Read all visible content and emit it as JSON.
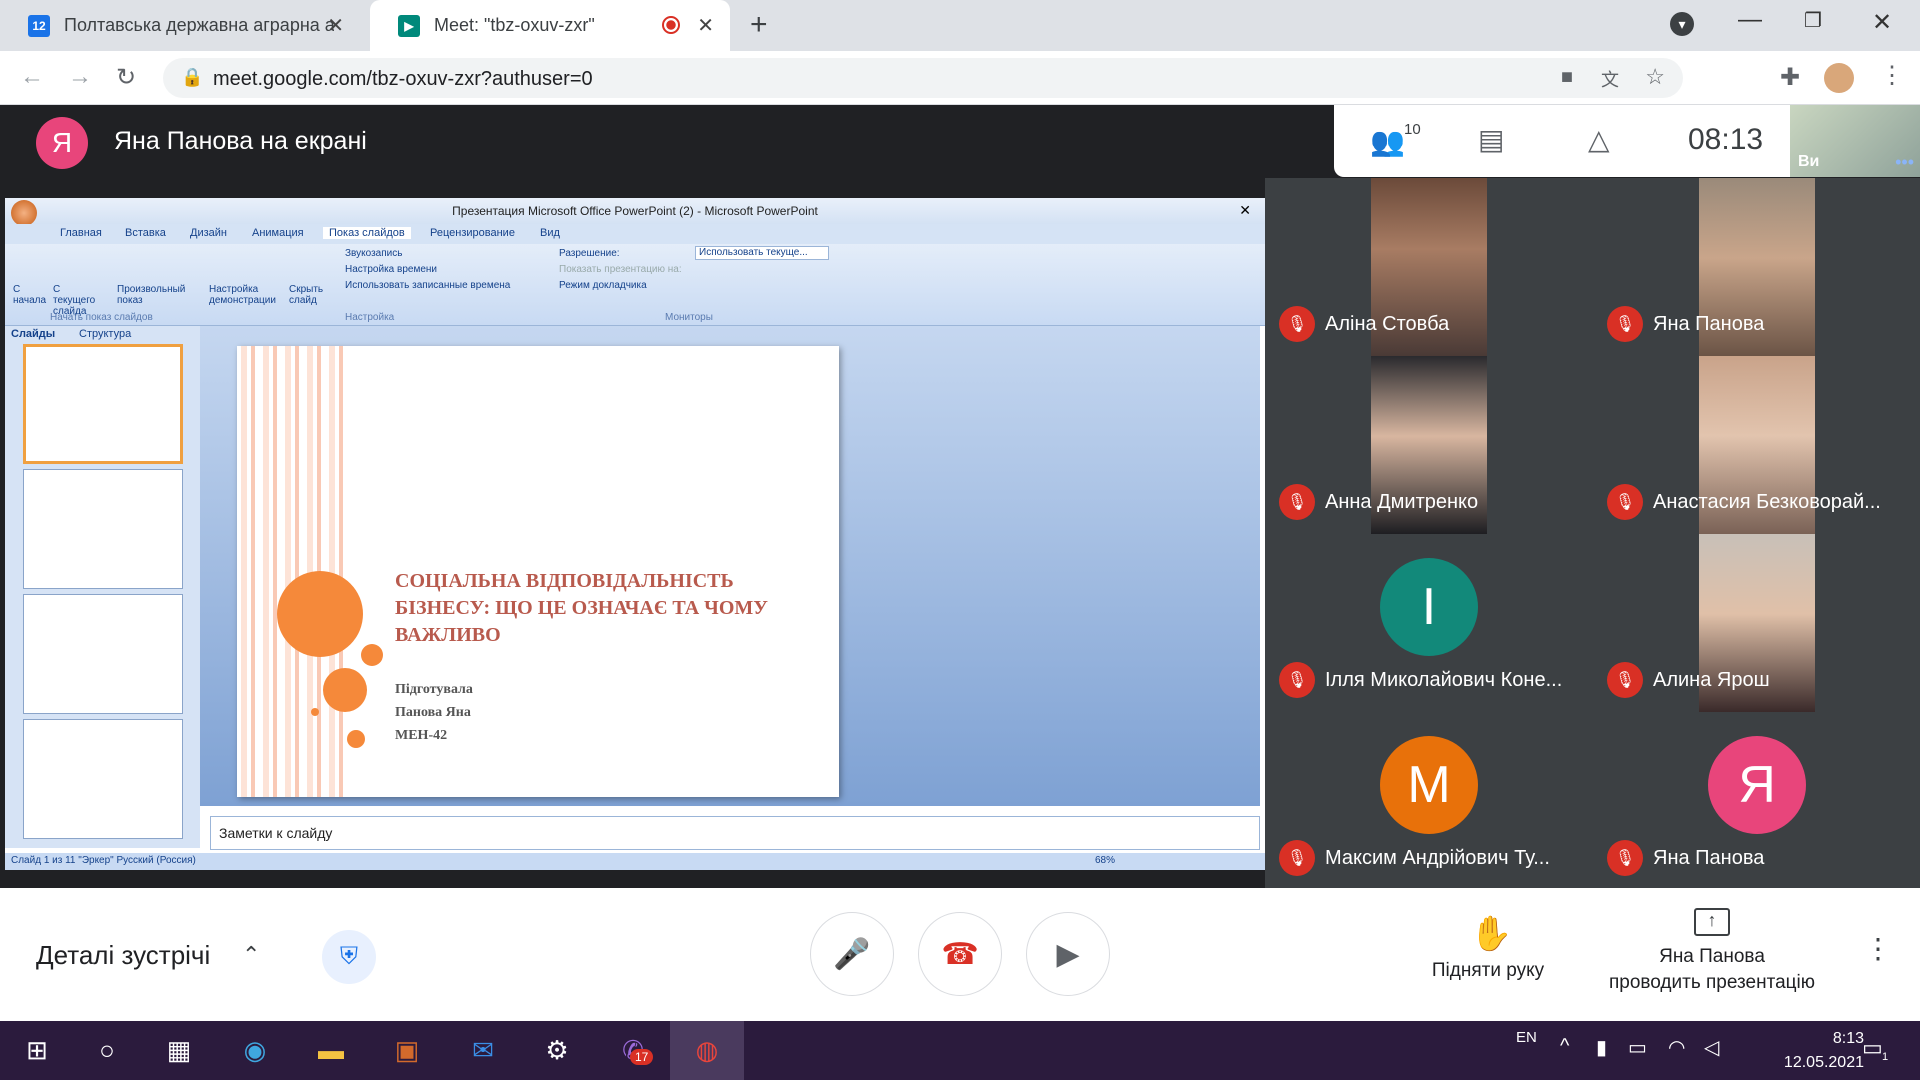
{
  "browser": {
    "tabs": [
      {
        "title": "Полтавська державна аграрна ак",
        "favicon": "12",
        "active": false
      },
      {
        "title": "Meet: \"tbz-oxuv-zxr\"",
        "active": true
      }
    ],
    "url": "meet.google.com/tbz-oxuv-zxr?authuser=0"
  },
  "meet": {
    "presenter_initial": "Я",
    "presenter_title": "Яна Панова на екрані",
    "participants_count": "10",
    "clock": "08:13",
    "self_label": "Ви",
    "participants": [
      {
        "name": "Аліна Стовба"
      },
      {
        "name": "Яна Панова"
      },
      {
        "name": "Анна Дмитренко"
      },
      {
        "name": "Анастасия Безковорай..."
      },
      {
        "name": "Ілля Миколайович Коне...",
        "initial": "I",
        "color": "#12897a"
      },
      {
        "name": "Алина Ярош"
      },
      {
        "name": "Максим Андрійович Ту...",
        "initial": "M",
        "color": "#e8710a"
      },
      {
        "name": "Яна Панова",
        "initial": "Я",
        "color": "#e8457b"
      }
    ],
    "details_label": "Деталі зустрічі",
    "raise_hand": "Підняти руку",
    "presenting_line1": "Яна Панова",
    "presenting_line2": "проводить презентацію"
  },
  "powerpoint": {
    "window_title": "Презентация Microsoft Office PowerPoint (2) - Microsoft PowerPoint",
    "tabs": [
      "Главная",
      "Вставка",
      "Дизайн",
      "Анимация",
      "Показ слайдов",
      "Рецензирование",
      "Вид"
    ],
    "ribbon": {
      "btn1": "С начала",
      "btn2": "С текущего слайда",
      "btn3": "Произвольный показ",
      "group1": "Начать показ слайдов",
      "btn4": "Настройка демонстрации",
      "btn5": "Скрыть слайд",
      "opt1": "Звукозапись",
      "opt2": "Настройка времени",
      "opt3": "Использовать записанные времена",
      "group2": "Настройка",
      "res_label": "Разрешение:",
      "res_value": "Использовать текуще...",
      "show_on": "Показать презентацию на:",
      "presenter_mode": "Режим докладчика",
      "group3": "Мониторы"
    },
    "pane_tabs": [
      "Слайды",
      "Структура"
    ],
    "slide_title": "СОЦІАЛЬНА ВІДПОВІДАЛЬНІСТЬ БІЗНЕСУ: ЩО ЦЕ ОЗНАЧАЄ ТА ЧОМУ ВАЖЛИВО",
    "slide_sub1": "Підготувала",
    "slide_sub2": "Панова Яна",
    "slide_sub3": "МЕН-42",
    "notes_placeholder": "Заметки к слайду",
    "status": "Слайд 1 из 11   \"Эркер\"   Русский (Россия)",
    "zoom": "68%"
  },
  "taskbar": {
    "lang": "EN",
    "time": "8:13",
    "date": "12.05.2021",
    "viber_badge": "17",
    "notif_count": "1"
  }
}
